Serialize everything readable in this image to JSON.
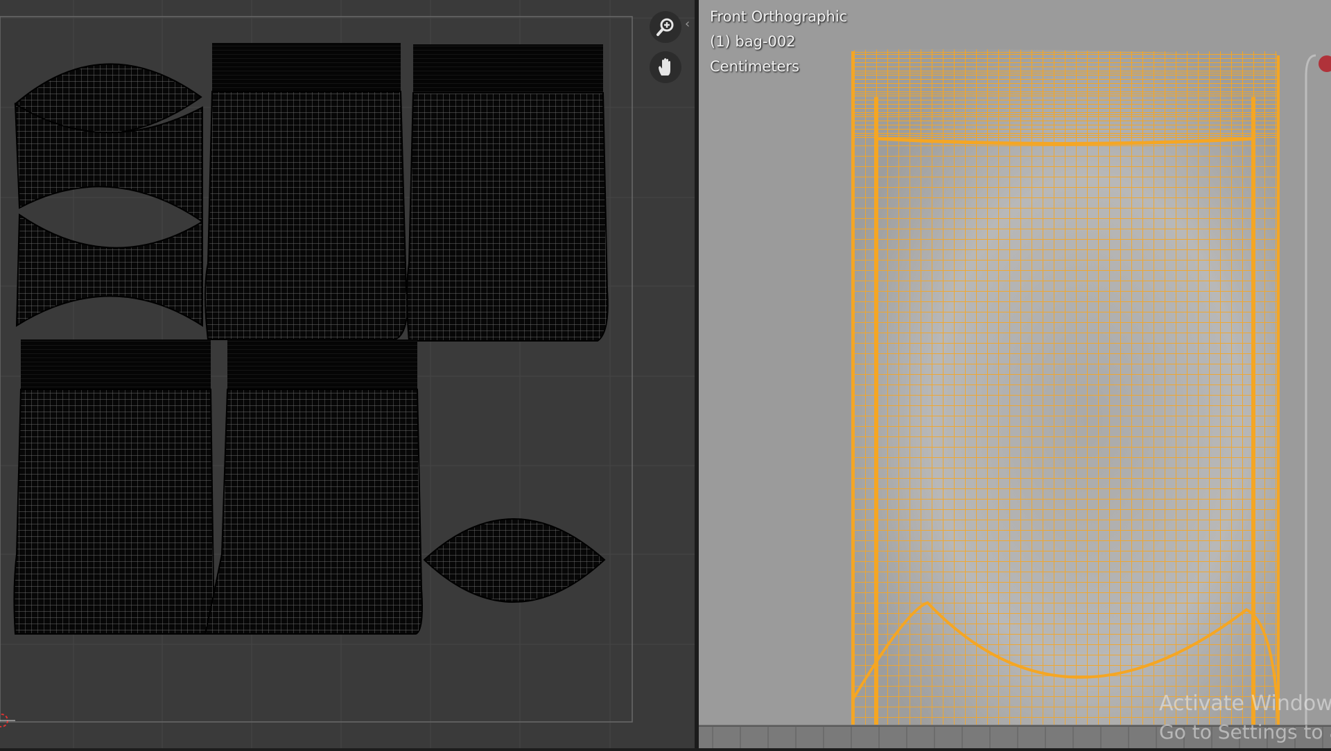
{
  "uv_editor": {
    "zoom_tool": "zoom-in-icon",
    "pan_tool": "hand-icon",
    "cursor": "2d-cursor-icon",
    "grid_color": "#4a4a4a",
    "island_color": "#0a0a0a"
  },
  "viewport": {
    "view_name": "Front Orthographic",
    "object_name": "(1) bag-002",
    "units": "Centimeters",
    "wire_color": "#f5a623",
    "background_color": "#9b9b9b"
  },
  "watermark": {
    "line1": "Activate Windows",
    "line2": "Go to Settings to act"
  }
}
